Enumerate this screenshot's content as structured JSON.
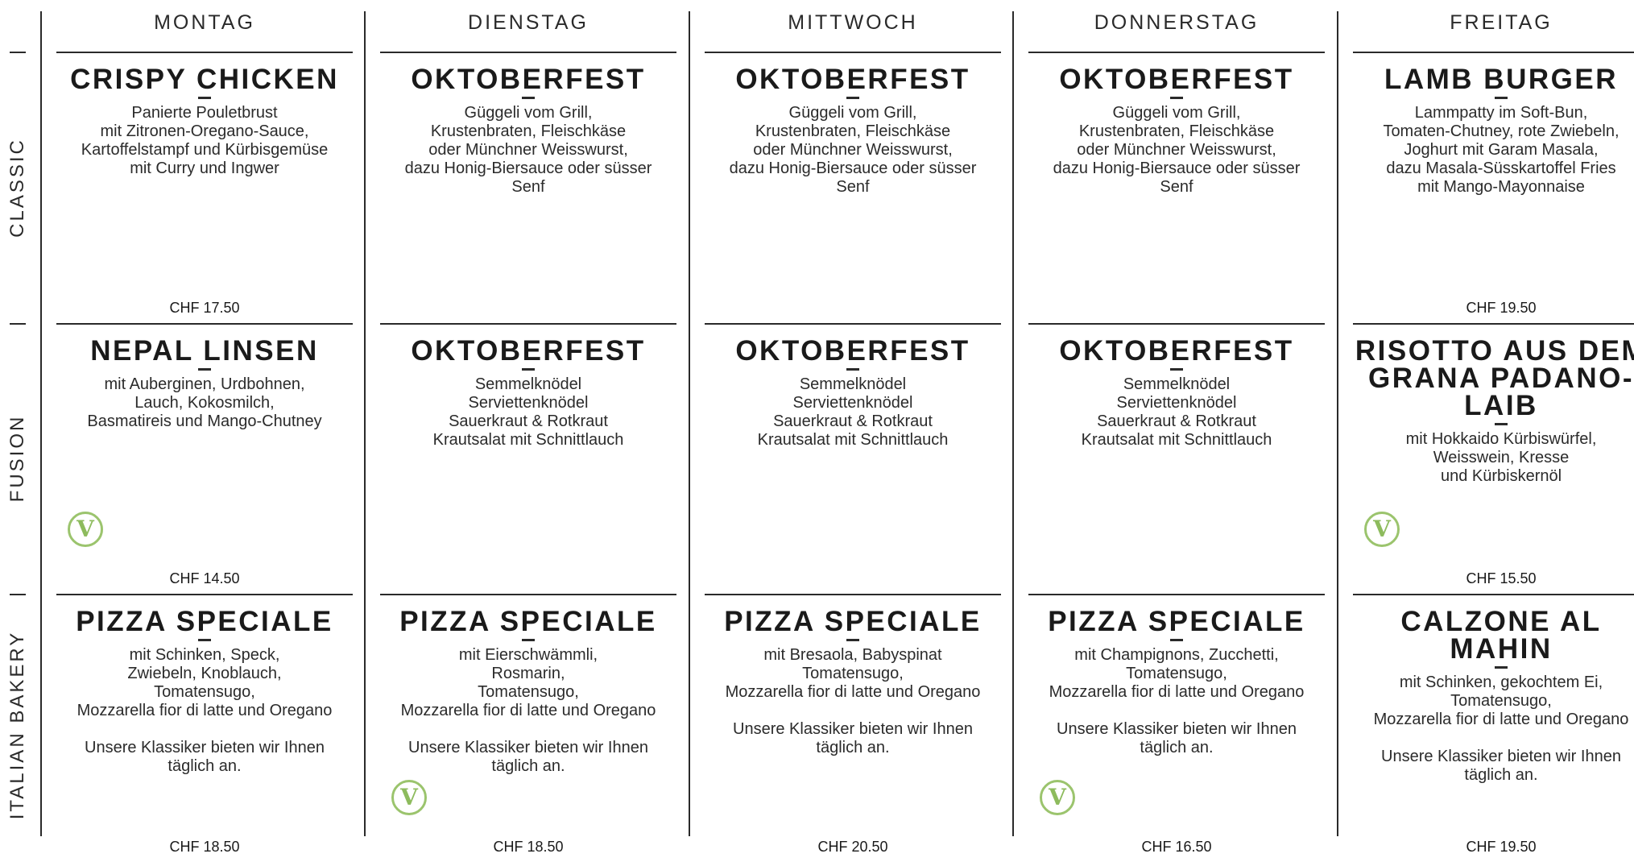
{
  "days": [
    "MONTAG",
    "DIENSTAG",
    "MITTWOCH",
    "DONNERSTAG",
    "FREITAG"
  ],
  "categories": [
    "CLASSIC",
    "FUSION",
    "ITALIAN BAKERY"
  ],
  "accent_color": "#8dbb5d",
  "veg_icon": "vegetarian-v-icon",
  "veg_symbol": "V",
  "menu": [
    [
      {
        "title": "CRISPY CHICKEN",
        "desc": "Panierte Pouletbrust\nmit Zitronen-Oregano-Sauce,\nKartoffelstampf und Kürbisgemüse\nmit Curry und Ingwer",
        "note": "",
        "price": "CHF 17.50",
        "veg": false
      },
      {
        "title": "OKTOBERFEST",
        "desc": "Güggeli vom Grill,\nKrustenbraten, Fleischkäse\noder Münchner Weisswurst,\ndazu Honig-Biersauce oder süsser\nSenf",
        "note": "",
        "price": "",
        "veg": false
      },
      {
        "title": "OKTOBERFEST",
        "desc": "Güggeli vom Grill,\nKrustenbraten, Fleischkäse\noder Münchner Weisswurst,\ndazu Honig-Biersauce oder süsser\nSenf",
        "note": "",
        "price": "",
        "veg": false
      },
      {
        "title": "OKTOBERFEST",
        "desc": "Güggeli vom Grill,\nKrustenbraten, Fleischkäse\noder Münchner Weisswurst,\ndazu Honig-Biersauce oder süsser\nSenf",
        "note": "",
        "price": "",
        "veg": false
      },
      {
        "title": "LAMB BURGER",
        "desc": "Lammpatty im Soft-Bun,\nTomaten-Chutney, rote Zwiebeln,\nJoghurt mit Garam Masala,\ndazu Masala-Süsskartoffel Fries\nmit Mango-Mayonnaise",
        "note": "",
        "price": "CHF 19.50",
        "veg": false
      }
    ],
    [
      {
        "title": "NEPAL LINSEN",
        "desc": "mit Auberginen, Urdbohnen,\nLauch, Kokosmilch,\nBasmatireis und Mango-Chutney",
        "note": "",
        "price": "CHF 14.50",
        "veg": true
      },
      {
        "title": "OKTOBERFEST",
        "desc": "Semmelknödel\nServiettenknödel\nSauerkraut & Rotkraut\nKrautsalat mit Schnittlauch",
        "note": "",
        "price": "",
        "veg": false
      },
      {
        "title": "OKTOBERFEST",
        "desc": "Semmelknödel\nServiettenknödel\nSauerkraut & Rotkraut\nKrautsalat mit Schnittlauch",
        "note": "",
        "price": "",
        "veg": false
      },
      {
        "title": "OKTOBERFEST",
        "desc": "Semmelknödel\nServiettenknödel\nSauerkraut & Rotkraut\nKrautsalat mit Schnittlauch",
        "note": "",
        "price": "",
        "veg": false
      },
      {
        "title": "RISOTTO AUS DEM GRANA PADANO-LAIB",
        "desc": "mit Hokkaido Kürbiswürfel,\nWeisswein, Kresse\nund Kürbiskernöl",
        "note": "",
        "price": "CHF 15.50",
        "veg": true
      }
    ],
    [
      {
        "title": "PIZZA SPECIALE",
        "desc": "mit Schinken, Speck,\nZwiebeln, Knoblauch,\nTomatensugo,\nMozzarella fior di latte und Oregano",
        "note": "Unsere Klassiker bieten wir Ihnen\ntäglich an.",
        "price": "CHF 18.50",
        "veg": false
      },
      {
        "title": "PIZZA SPECIALE",
        "desc": "mit Eierschwämmli,\nRosmarin,\nTomatensugo,\nMozzarella fior di latte und Oregano",
        "note": "Unsere Klassiker bieten wir Ihnen\ntäglich an.",
        "price": "CHF 18.50",
        "veg": true
      },
      {
        "title": "PIZZA SPECIALE",
        "desc": "mit Bresaola, Babyspinat\nTomatensugo,\nMozzarella fior di latte und Oregano",
        "note": "Unsere Klassiker bieten wir Ihnen\ntäglich an.",
        "price": "CHF 20.50",
        "veg": false
      },
      {
        "title": "PIZZA SPECIALE",
        "desc": "mit Champignons, Zucchetti,\nTomatensugo,\nMozzarella fior di latte und Oregano",
        "note": "Unsere Klassiker bieten wir Ihnen\ntäglich an.",
        "price": "CHF 16.50",
        "veg": true
      },
      {
        "title": "CALZONE AL MAHIN",
        "desc": "mit Schinken, gekochtem Ei,\nTomatensugo,\nMozzarella fior di latte und Oregano",
        "note": "Unsere Klassiker bieten wir Ihnen\ntäglich an.",
        "price": "CHF 19.50",
        "veg": false
      }
    ]
  ]
}
